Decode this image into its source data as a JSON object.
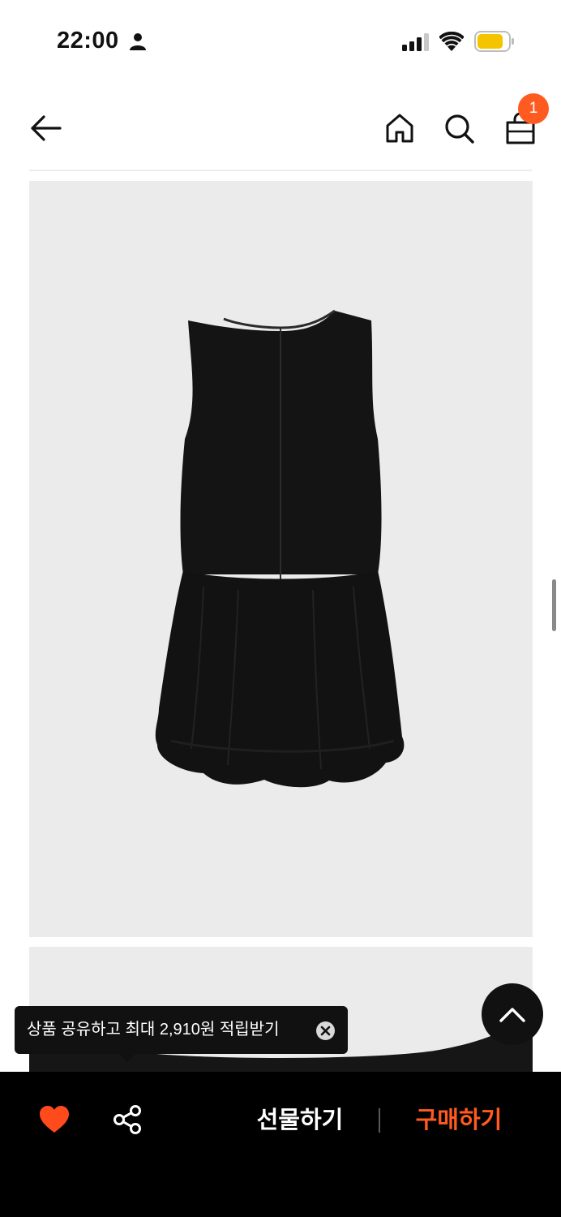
{
  "status_bar": {
    "time": "22:00",
    "icons": [
      "person-icon",
      "signal-icon",
      "wifi-icon",
      "battery-icon"
    ],
    "battery_color": "#f5c400"
  },
  "nav": {
    "cart_count": "1",
    "icons": [
      "back-arrow-icon",
      "home-icon",
      "search-icon",
      "shopping-bag-icon"
    ],
    "badge_color": "#ff5a1f"
  },
  "product": {
    "images": [
      "black-sleeveless-bubble-dress-back-view",
      "black-dress-detail"
    ],
    "image_background": "#ebebeb"
  },
  "share_tooltip": {
    "text": "상품 공유하고 최대 2,910원 적립받기"
  },
  "bottom_bar": {
    "gift_label": "선물하기",
    "buy_label": "구매하기",
    "accent_color": "#ff5a1f",
    "icons": [
      "heart-icon",
      "share-icon"
    ]
  }
}
